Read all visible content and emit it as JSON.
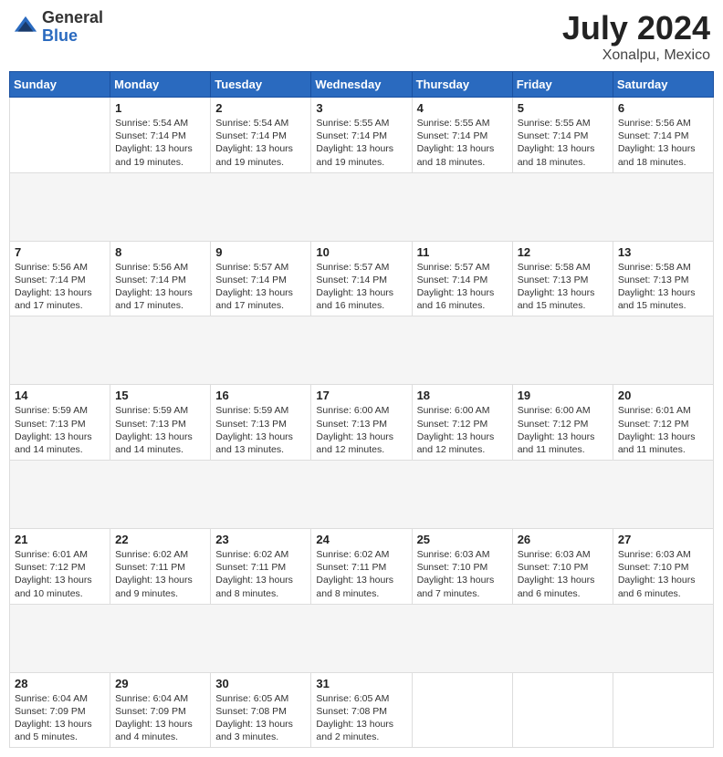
{
  "header": {
    "logo_general": "General",
    "logo_blue": "Blue",
    "title": "July 2024",
    "subtitle": "Xonalpu, Mexico"
  },
  "calendar": {
    "days_of_week": [
      "Sunday",
      "Monday",
      "Tuesday",
      "Wednesday",
      "Thursday",
      "Friday",
      "Saturday"
    ],
    "weeks": [
      [
        {
          "day": "",
          "sunrise": "",
          "sunset": "",
          "daylight": ""
        },
        {
          "day": "1",
          "sunrise": "Sunrise: 5:54 AM",
          "sunset": "Sunset: 7:14 PM",
          "daylight": "Daylight: 13 hours and 19 minutes."
        },
        {
          "day": "2",
          "sunrise": "Sunrise: 5:54 AM",
          "sunset": "Sunset: 7:14 PM",
          "daylight": "Daylight: 13 hours and 19 minutes."
        },
        {
          "day": "3",
          "sunrise": "Sunrise: 5:55 AM",
          "sunset": "Sunset: 7:14 PM",
          "daylight": "Daylight: 13 hours and 19 minutes."
        },
        {
          "day": "4",
          "sunrise": "Sunrise: 5:55 AM",
          "sunset": "Sunset: 7:14 PM",
          "daylight": "Daylight: 13 hours and 18 minutes."
        },
        {
          "day": "5",
          "sunrise": "Sunrise: 5:55 AM",
          "sunset": "Sunset: 7:14 PM",
          "daylight": "Daylight: 13 hours and 18 minutes."
        },
        {
          "day": "6",
          "sunrise": "Sunrise: 5:56 AM",
          "sunset": "Sunset: 7:14 PM",
          "daylight": "Daylight: 13 hours and 18 minutes."
        }
      ],
      [
        {
          "day": "7",
          "sunrise": "Sunrise: 5:56 AM",
          "sunset": "Sunset: 7:14 PM",
          "daylight": "Daylight: 13 hours and 17 minutes."
        },
        {
          "day": "8",
          "sunrise": "Sunrise: 5:56 AM",
          "sunset": "Sunset: 7:14 PM",
          "daylight": "Daylight: 13 hours and 17 minutes."
        },
        {
          "day": "9",
          "sunrise": "Sunrise: 5:57 AM",
          "sunset": "Sunset: 7:14 PM",
          "daylight": "Daylight: 13 hours and 17 minutes."
        },
        {
          "day": "10",
          "sunrise": "Sunrise: 5:57 AM",
          "sunset": "Sunset: 7:14 PM",
          "daylight": "Daylight: 13 hours and 16 minutes."
        },
        {
          "day": "11",
          "sunrise": "Sunrise: 5:57 AM",
          "sunset": "Sunset: 7:14 PM",
          "daylight": "Daylight: 13 hours and 16 minutes."
        },
        {
          "day": "12",
          "sunrise": "Sunrise: 5:58 AM",
          "sunset": "Sunset: 7:13 PM",
          "daylight": "Daylight: 13 hours and 15 minutes."
        },
        {
          "day": "13",
          "sunrise": "Sunrise: 5:58 AM",
          "sunset": "Sunset: 7:13 PM",
          "daylight": "Daylight: 13 hours and 15 minutes."
        }
      ],
      [
        {
          "day": "14",
          "sunrise": "Sunrise: 5:59 AM",
          "sunset": "Sunset: 7:13 PM",
          "daylight": "Daylight: 13 hours and 14 minutes."
        },
        {
          "day": "15",
          "sunrise": "Sunrise: 5:59 AM",
          "sunset": "Sunset: 7:13 PM",
          "daylight": "Daylight: 13 hours and 14 minutes."
        },
        {
          "day": "16",
          "sunrise": "Sunrise: 5:59 AM",
          "sunset": "Sunset: 7:13 PM",
          "daylight": "Daylight: 13 hours and 13 minutes."
        },
        {
          "day": "17",
          "sunrise": "Sunrise: 6:00 AM",
          "sunset": "Sunset: 7:13 PM",
          "daylight": "Daylight: 13 hours and 12 minutes."
        },
        {
          "day": "18",
          "sunrise": "Sunrise: 6:00 AM",
          "sunset": "Sunset: 7:12 PM",
          "daylight": "Daylight: 13 hours and 12 minutes."
        },
        {
          "day": "19",
          "sunrise": "Sunrise: 6:00 AM",
          "sunset": "Sunset: 7:12 PM",
          "daylight": "Daylight: 13 hours and 11 minutes."
        },
        {
          "day": "20",
          "sunrise": "Sunrise: 6:01 AM",
          "sunset": "Sunset: 7:12 PM",
          "daylight": "Daylight: 13 hours and 11 minutes."
        }
      ],
      [
        {
          "day": "21",
          "sunrise": "Sunrise: 6:01 AM",
          "sunset": "Sunset: 7:12 PM",
          "daylight": "Daylight: 13 hours and 10 minutes."
        },
        {
          "day": "22",
          "sunrise": "Sunrise: 6:02 AM",
          "sunset": "Sunset: 7:11 PM",
          "daylight": "Daylight: 13 hours and 9 minutes."
        },
        {
          "day": "23",
          "sunrise": "Sunrise: 6:02 AM",
          "sunset": "Sunset: 7:11 PM",
          "daylight": "Daylight: 13 hours and 8 minutes."
        },
        {
          "day": "24",
          "sunrise": "Sunrise: 6:02 AM",
          "sunset": "Sunset: 7:11 PM",
          "daylight": "Daylight: 13 hours and 8 minutes."
        },
        {
          "day": "25",
          "sunrise": "Sunrise: 6:03 AM",
          "sunset": "Sunset: 7:10 PM",
          "daylight": "Daylight: 13 hours and 7 minutes."
        },
        {
          "day": "26",
          "sunrise": "Sunrise: 6:03 AM",
          "sunset": "Sunset: 7:10 PM",
          "daylight": "Daylight: 13 hours and 6 minutes."
        },
        {
          "day": "27",
          "sunrise": "Sunrise: 6:03 AM",
          "sunset": "Sunset: 7:10 PM",
          "daylight": "Daylight: 13 hours and 6 minutes."
        }
      ],
      [
        {
          "day": "28",
          "sunrise": "Sunrise: 6:04 AM",
          "sunset": "Sunset: 7:09 PM",
          "daylight": "Daylight: 13 hours and 5 minutes."
        },
        {
          "day": "29",
          "sunrise": "Sunrise: 6:04 AM",
          "sunset": "Sunset: 7:09 PM",
          "daylight": "Daylight: 13 hours and 4 minutes."
        },
        {
          "day": "30",
          "sunrise": "Sunrise: 6:05 AM",
          "sunset": "Sunset: 7:08 PM",
          "daylight": "Daylight: 13 hours and 3 minutes."
        },
        {
          "day": "31",
          "sunrise": "Sunrise: 6:05 AM",
          "sunset": "Sunset: 7:08 PM",
          "daylight": "Daylight: 13 hours and 2 minutes."
        },
        {
          "day": "",
          "sunrise": "",
          "sunset": "",
          "daylight": ""
        },
        {
          "day": "",
          "sunrise": "",
          "sunset": "",
          "daylight": ""
        },
        {
          "day": "",
          "sunrise": "",
          "sunset": "",
          "daylight": ""
        }
      ]
    ]
  }
}
